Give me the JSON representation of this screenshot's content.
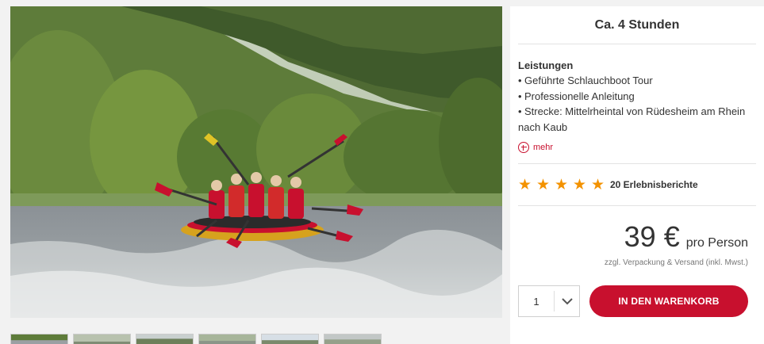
{
  "product": {
    "duration": "Ca. 4 Stunden",
    "services_title": "Leistungen",
    "services": [
      "Geführte Schlauchboot Tour",
      "Professionelle Anleitung",
      "Strecke: Mittelrheintal von Rüdesheim am Rhein nach Kaub"
    ],
    "more_label": "mehr",
    "rating": {
      "stars": 5,
      "max_stars": 5,
      "label": "20 Erlebnisberichte"
    },
    "price": {
      "amount": "39 €",
      "unit": "pro Person",
      "note": "zzgl. Verpackung & Versand (inkl. Mwst.)"
    },
    "quantity": "1",
    "cart_button": "IN DEN WARENKORB"
  },
  "gallery": {
    "thumbnail_count": 6
  },
  "colors": {
    "accent": "#c8102e",
    "star": "#f39200",
    "panel_bg": "#ffffff",
    "page_bg": "#f2f2f2"
  },
  "icons": {
    "more": "plus-circle-icon",
    "rating": "star-icon",
    "quantity": "chevron-down-icon"
  }
}
